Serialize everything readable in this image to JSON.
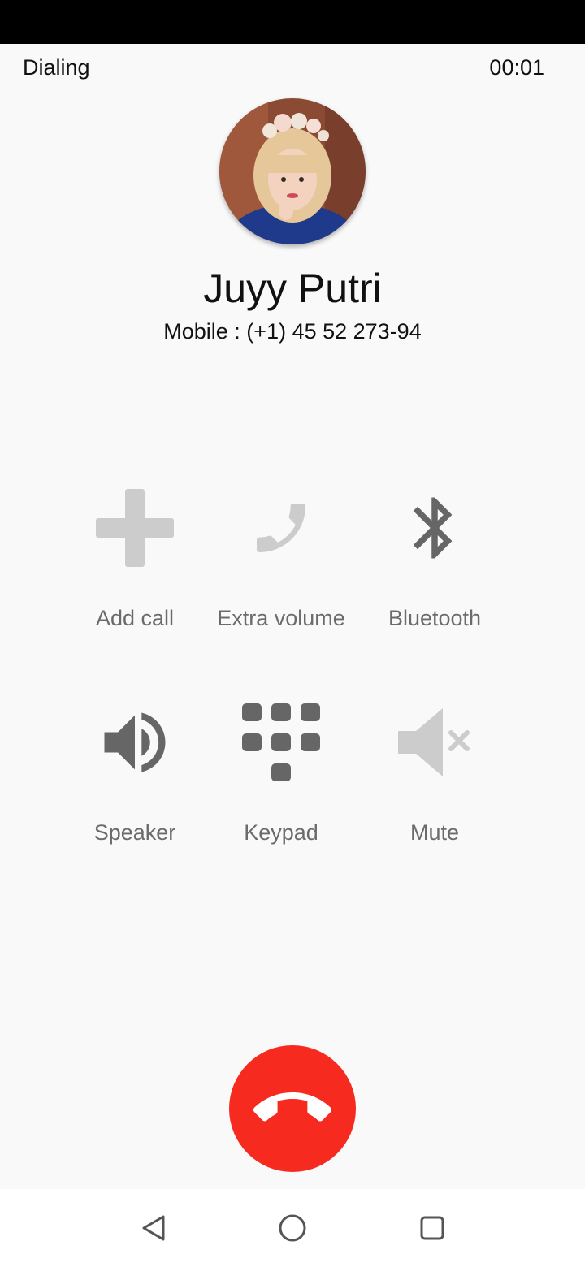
{
  "call": {
    "state": "Dialing",
    "timer": "00:01"
  },
  "contact": {
    "name": "Juyy Putri",
    "number": "Mobile : (+1) 45 52 273-94"
  },
  "controls": [
    {
      "label": "Add call",
      "icon": "add-icon",
      "enabled": false
    },
    {
      "label": "Extra volume",
      "icon": "phone-icon",
      "enabled": false
    },
    {
      "label": "Bluetooth",
      "icon": "bluetooth-icon",
      "enabled": true
    },
    {
      "label": "Speaker",
      "icon": "speaker-icon",
      "enabled": true
    },
    {
      "label": "Keypad",
      "icon": "keypad-icon",
      "enabled": true
    },
    {
      "label": "Mute",
      "icon": "mute-icon",
      "enabled": false
    }
  ],
  "colors": {
    "end_call": "#f72a1f",
    "icon_enabled": "#666666",
    "icon_disabled": "#cccccc",
    "label": "#6b6b6b"
  },
  "nav": {
    "back_icon": "back-triangle-icon",
    "home_icon": "home-circle-icon",
    "recents_icon": "recents-square-icon"
  }
}
